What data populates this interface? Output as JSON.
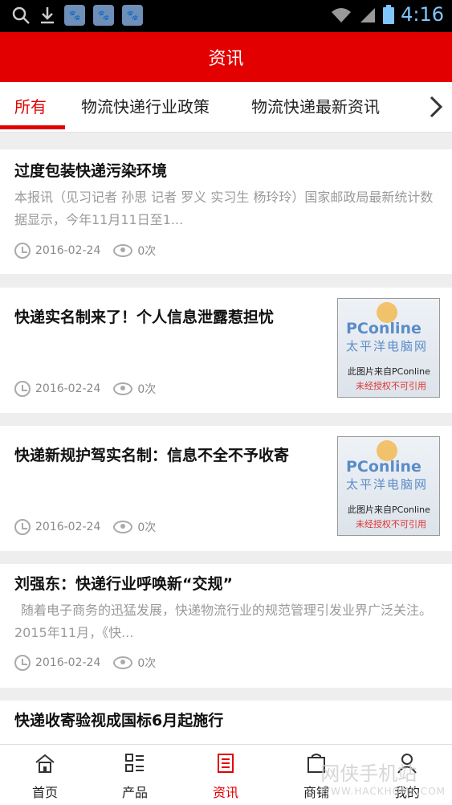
{
  "status_bar": {
    "time": "4:16"
  },
  "header": {
    "title": "资讯"
  },
  "tabs": [
    {
      "label": "所有",
      "active": true
    },
    {
      "label": "物流快递行业政策",
      "active": false
    },
    {
      "label": "物流快递最新资讯",
      "active": false
    }
  ],
  "articles": [
    {
      "title": "过度包装快递污染环境",
      "description": "本报讯（见习记者 孙思 记者 罗义 实习生 杨玲玲）国家邮政局最新统计数据显示，今年11月11日至1...",
      "date": "2016-02-24",
      "views": "0次"
    },
    {
      "title": "快递实名制来了！个人信息泄露惹担忧",
      "date": "2016-02-24",
      "views": "0次",
      "image": {
        "brand": "PConline",
        "brand_cn": "太平洋电脑网",
        "caption1": "此图片来自PConline",
        "caption2": "未经授权不可引用"
      }
    },
    {
      "title": "快递新规护驾实名制：信息不全不予收寄",
      "date": "2016-02-24",
      "views": "0次",
      "image": {
        "brand": "PConline",
        "brand_cn": "太平洋电脑网",
        "caption1": "此图片来自PConline",
        "caption2": "未经授权不可引用"
      }
    },
    {
      "title": "刘强东：快递行业呼唤新“交规”",
      "description": "随着电子商务的迅猛发展，快递物流行业的规范管理引发业界广泛关注。2015年11月，《快...",
      "date": "2016-02-24",
      "views": "0次"
    },
    {
      "title": "快递收寄验视成国标6月起施行"
    }
  ],
  "bottom_nav": [
    {
      "label": "首页",
      "icon": "home-icon",
      "active": false
    },
    {
      "label": "产品",
      "icon": "grid-list-icon",
      "active": false
    },
    {
      "label": "资讯",
      "icon": "document-icon",
      "active": true
    },
    {
      "label": "商铺",
      "icon": "shop-icon",
      "active": false
    },
    {
      "label": "我的",
      "icon": "user-icon",
      "active": false
    }
  ],
  "watermark": {
    "text": "网侠手机站",
    "url": "WWW.HACKHOME.COM"
  },
  "colors": {
    "accent": "#e30000",
    "background": "#eeeeee"
  }
}
